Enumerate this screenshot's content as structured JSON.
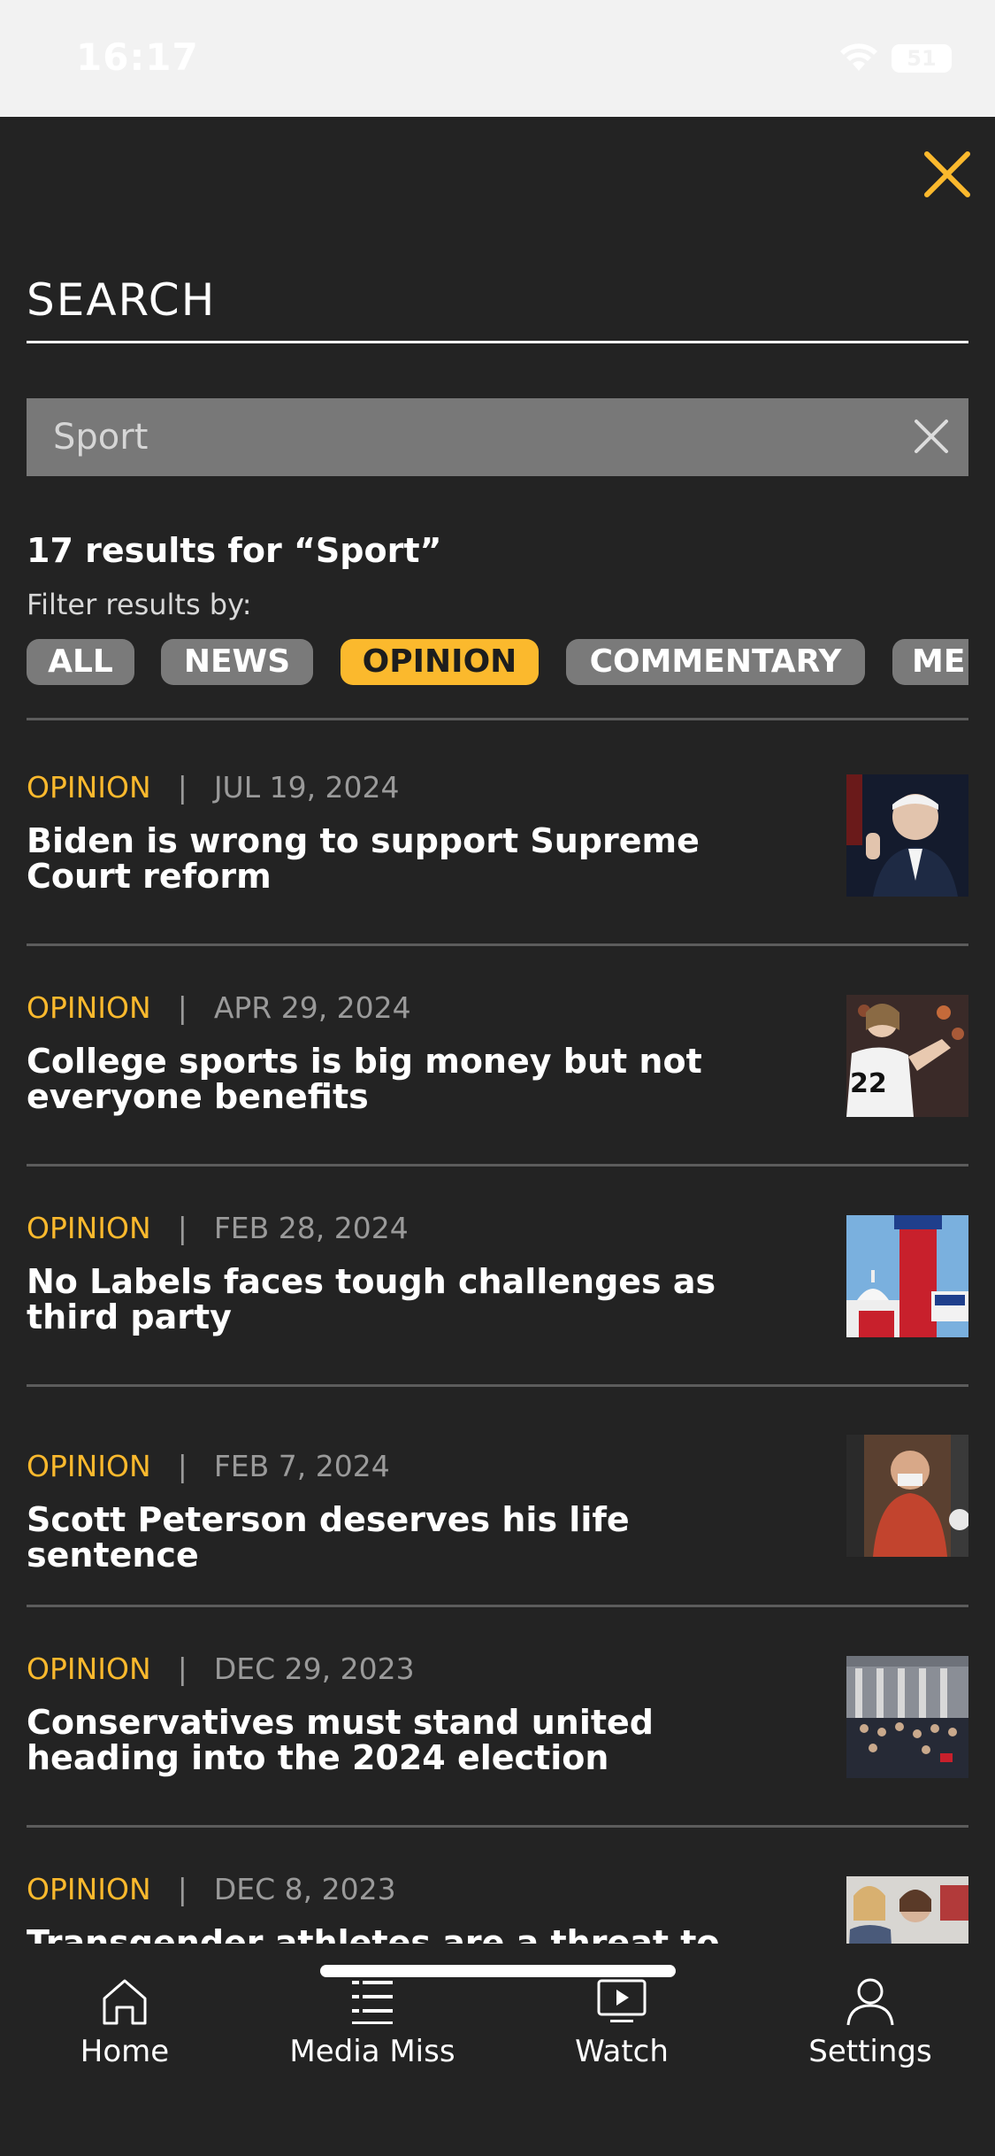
{
  "status_bar": {
    "time": "16:17",
    "battery": "51"
  },
  "search": {
    "title": "SEARCH",
    "query": "Sport",
    "results_label": "17 results for “Sport”",
    "filter_label": "Filter results by:"
  },
  "filters": [
    "ALL",
    "NEWS",
    "OPINION",
    "COMMENTARY",
    "ME"
  ],
  "active_filter": "OPINION",
  "articles": [
    {
      "category": "OPINION",
      "separator": "|",
      "date": "JUL 19, 2024",
      "title": "Biden is wrong to support Supreme Court reform",
      "thumb": "biden-podium-photo"
    },
    {
      "category": "OPINION",
      "separator": "|",
      "date": "APR 29, 2024",
      "title": "College sports is big money but not everyone benefits",
      "thumb": "iowa-basketball-player-photo"
    },
    {
      "category": "OPINION",
      "separator": "|",
      "date": "FEB 28, 2024",
      "title": "No Labels faces tough challenges as third party",
      "thumb": "no-labels-signs-capitol-photo"
    },
    {
      "category": "OPINION",
      "separator": "|",
      "date": "FEB 7, 2024",
      "title": "Scott Peterson deserves his life sentence",
      "thumb": "courtroom-photo"
    },
    {
      "category": "OPINION",
      "separator": "|",
      "date": "DEC 29, 2023",
      "title": "Conservatives must stand united heading into the 2024 election",
      "thumb": "capitol-crowd-photo"
    },
    {
      "category": "OPINION",
      "separator": "|",
      "date": "DEC 8, 2023",
      "title": "Transgender athletes are a threat to",
      "thumb": "press-conference-photo"
    }
  ],
  "nav": [
    {
      "label": "Home",
      "icon": "home-icon"
    },
    {
      "label": "Media Miss",
      "icon": "list-icon"
    },
    {
      "label": "Watch",
      "icon": "play-screen-icon"
    },
    {
      "label": "Settings",
      "icon": "person-icon"
    }
  ],
  "colors": {
    "accent": "#fbb92d",
    "background": "#232323",
    "chip": "#7a7a7a"
  }
}
